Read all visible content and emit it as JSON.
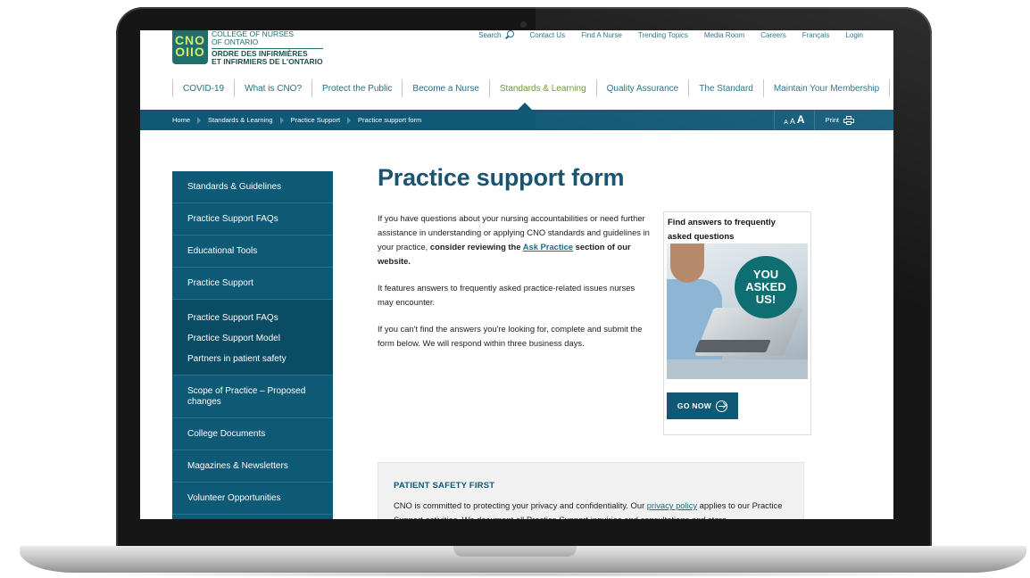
{
  "logo": {
    "mark": "CNO OIIO"
  },
  "org": {
    "en_line1": "College of Nurses",
    "en_line2": "of Ontario",
    "fr_line1": "Ordre des infirmières",
    "fr_line2": "et infirmiers de l'Ontario"
  },
  "utility": {
    "search": "Search",
    "links": [
      "Contact Us",
      "Find A Nurse",
      "Trending Topics",
      "Media Room",
      "Careers",
      "Français",
      "Login"
    ]
  },
  "nav": {
    "items": [
      "COVID-19",
      "What is CNO?",
      "Protect the Public",
      "Become a Nurse",
      "Standards & Learning",
      "Quality Assurance",
      "The Standard",
      "Maintain Your Membership"
    ],
    "active": "Standards & Learning"
  },
  "breadcrumb": [
    "Home",
    "Standards & Learning",
    "Practice Support",
    "Practice support form"
  ],
  "tools": {
    "size_small": "A",
    "size_medium": "A",
    "size_large": "A",
    "print": "Print"
  },
  "sidebar": {
    "items": [
      "Standards & Guidelines",
      "Practice Support FAQs",
      "Educational Tools",
      "Practice Support"
    ],
    "subitems": [
      "Practice Support FAQs",
      "Practice Support Model",
      "Partners in patient safety"
    ],
    "items_after": [
      "Scope of Practice – Proposed changes",
      "College Documents",
      "Magazines & Newsletters",
      "Volunteer Opportunities"
    ]
  },
  "main": {
    "title": "Practice support form",
    "p1_text": "If you have questions about your nursing accountabilities or need further assistance in understanding or applying CNO standards and guidelines in your practice, ",
    "p1_bold": "consider reviewing the ",
    "p1_link": "Ask Practice",
    "p1_bold_end": " section of our website.",
    "p2": "It features answers to frequently asked practice-related issues nurses may encounter.",
    "p3": "If you can't find the answers you're looking for, complete and submit the form below. We will respond within three business days."
  },
  "card": {
    "title": "Find answers to frequently asked questions",
    "badge_line1": "YOU",
    "badge_line2": "ASKED",
    "badge_line3": "US!",
    "button": "GO NOW"
  },
  "notice": {
    "title": "PATIENT SAFETY FIRST",
    "text_start": "CNO is committed to protecting your privacy and confidentiality. Our ",
    "link": "privacy policy",
    "text_end": " applies to our Practice Support activities. We document all Practice Support inquiries and consultations and store"
  },
  "colors": {
    "brand_teal": "#0f5876",
    "accent_green": "#6a9a2a",
    "logo_green": "#1f6f6e"
  }
}
